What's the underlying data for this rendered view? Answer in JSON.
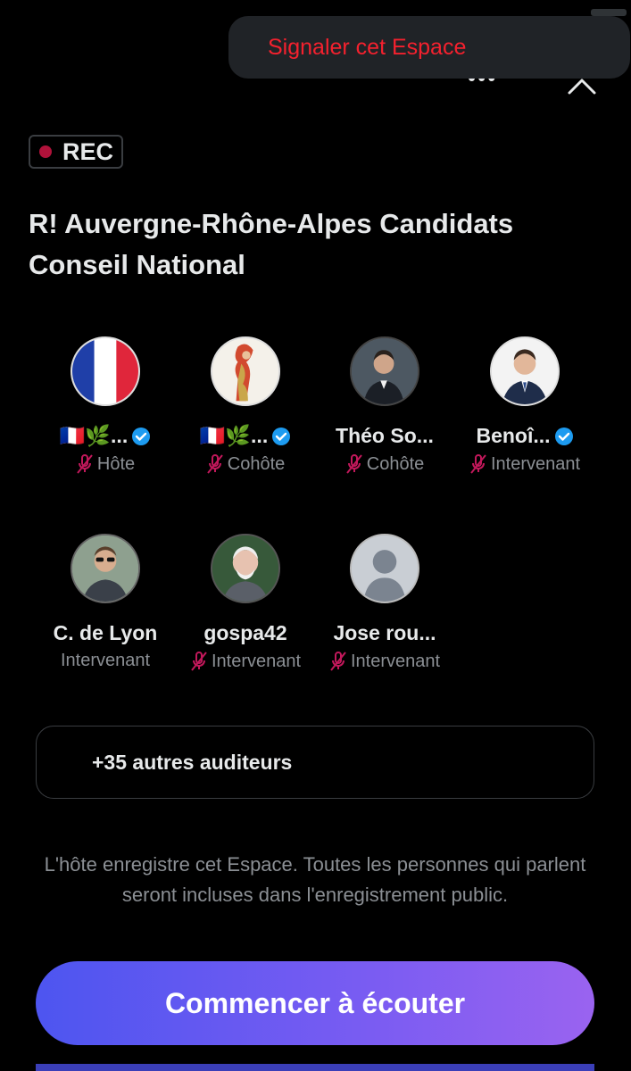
{
  "menu": {
    "report_label": "Signaler cet Espace"
  },
  "recording": {
    "badge": "REC"
  },
  "space": {
    "title": "R! Auvergne-Rhône-Alpes Candidats Conseil National"
  },
  "participants": [
    {
      "name": "🇫🇷🌿...",
      "verified": true,
      "muted": true,
      "role": "Hôte",
      "avatar": "french-flag"
    },
    {
      "name": "🇫🇷🌿...",
      "verified": true,
      "muted": true,
      "role": "Cohôte",
      "avatar": "illustration"
    },
    {
      "name": "Théo So...",
      "verified": false,
      "muted": true,
      "role": "Cohôte",
      "avatar": "photo"
    },
    {
      "name": "Benoî...",
      "verified": true,
      "muted": true,
      "role": "Intervenant",
      "avatar": "photo"
    },
    {
      "name": "C. de Lyon",
      "verified": false,
      "muted": false,
      "role": "Intervenant",
      "avatar": "photo"
    },
    {
      "name": "gospa42",
      "verified": false,
      "muted": true,
      "role": "Intervenant",
      "avatar": "photo"
    },
    {
      "name": "Jose rou...",
      "verified": false,
      "muted": true,
      "role": "Intervenant",
      "avatar": "default"
    }
  ],
  "listeners": {
    "label": "+35 autres auditeurs"
  },
  "notice": {
    "text": "L'hôte enregistre cet Espace. Toutes les personnes qui parlent seront incluses dans l'enregistrement public."
  },
  "actions": {
    "start_label": "Commencer à écouter"
  },
  "colors": {
    "background": "#000000",
    "danger": "#f4212e",
    "verified": "#1d9bf0",
    "muted_mic": "#c2185b",
    "button_start": "#4d55f0",
    "button_end": "#9a63f0"
  }
}
